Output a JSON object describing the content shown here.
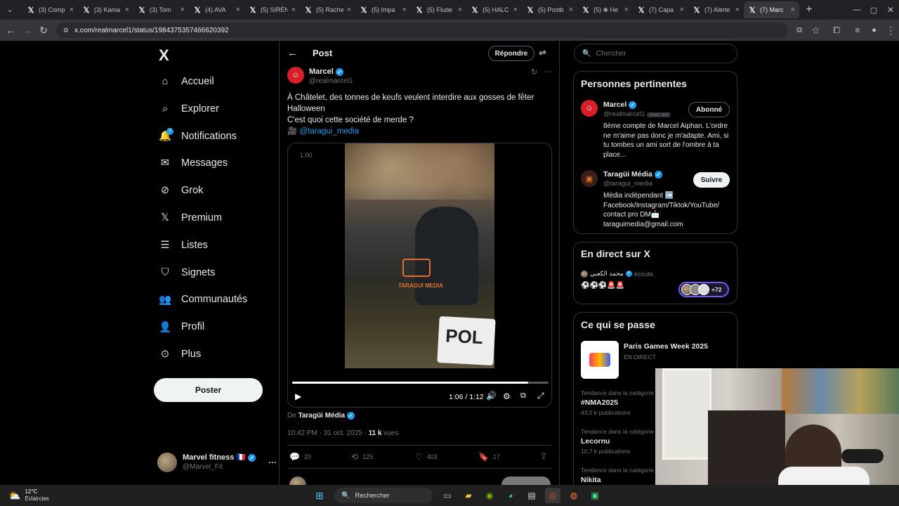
{
  "browser": {
    "tabs": [
      {
        "label": "(3) Comp"
      },
      {
        "label": "(3) Kama"
      },
      {
        "label": "(3) Tom"
      },
      {
        "label": "(4) AVA"
      },
      {
        "label": "(5) SIRÈN"
      },
      {
        "label": "(5) Rache"
      },
      {
        "label": "(5) Impa"
      },
      {
        "label": "(5) Flude"
      },
      {
        "label": "(5) HALC"
      },
      {
        "label": "(5) Postb"
      },
      {
        "label": "(5) ❀ He"
      },
      {
        "label": "(7) Capa"
      },
      {
        "label": "(7) Alerte"
      },
      {
        "label": "(7) Marc"
      }
    ],
    "url": "x.com/realmarcel1/status/1984375357466620392"
  },
  "nav": {
    "logo": "X",
    "items": [
      {
        "label": "Accueil",
        "icon": "home-icon"
      },
      {
        "label": "Explorer",
        "icon": "search-icon"
      },
      {
        "label": "Notifications",
        "icon": "bell-icon",
        "badge": "7"
      },
      {
        "label": "Messages",
        "icon": "mail-icon"
      },
      {
        "label": "Grok",
        "icon": "grok-icon"
      },
      {
        "label": "Premium",
        "icon": "x-premium-icon"
      },
      {
        "label": "Listes",
        "icon": "list-icon"
      },
      {
        "label": "Signets",
        "icon": "bookmark-icon"
      },
      {
        "label": "Communautés",
        "icon": "communities-icon"
      },
      {
        "label": "Profil",
        "icon": "profile-icon"
      },
      {
        "label": "Plus",
        "icon": "more-circle-icon"
      }
    ],
    "post_button": "Poster",
    "account": {
      "name": "Marvel fitness 🇫🇷",
      "handle": "@Marvel_Fit"
    }
  },
  "post": {
    "header": "Post",
    "reply_button": "Répondre",
    "author": {
      "name": "Marcel",
      "handle": "@realmarcel1"
    },
    "text_line1": "À Châtelet, des tonnes de keufs veulent interdire aux gosses de fêter Halloween",
    "text_line2": "C'est quoi cette société de merde ?",
    "mention": "@taragui_media",
    "video": {
      "speed": "1.00",
      "watermark": "TARAGUI MEDIA",
      "time": "1:06 / 1:12",
      "progress": 0.92
    },
    "from_label": "De",
    "from_name": "Taragüi Média",
    "timestamp": "10:42 PM · 31 oct. 2025 ·",
    "views_count": "11 k",
    "views_label": "vues",
    "stats": {
      "replies": "20",
      "reposts": "125",
      "likes": "403",
      "bookmarks": "17"
    }
  },
  "right": {
    "search_placeholder": "Chercher",
    "relevant": {
      "title": "Personnes pertinentes",
      "people": [
        {
          "name": "Marcel",
          "handle": "@realmarcel1",
          "follows_you": "Vous suit",
          "button": "Abonné",
          "bio": "8ème compte de Marcel Aiphan. L'ordre ne m'aime pas donc je m'adapte. Ami, si tu tombes un ami sort de l'ombre à ta place..."
        },
        {
          "name": "Taragüi Média",
          "handle": "@taragui_media",
          "button": "Suivre",
          "bio": "Média indépendant ➡️ Facebook/Instagram/Tiktok/YouTube/ contact pro DM📩 taraguimedia@gmail.com"
        }
      ]
    },
    "live": {
      "title": "En direct sur X",
      "host": "محمد الكعبي",
      "status": "écoute.",
      "emojis": "⚽⚽⚽🚨🚨",
      "listeners": "+72"
    },
    "trends": {
      "title": "Ce qui se passe",
      "event": {
        "name": "Paris Games Week 2025",
        "status": "EN DIRECT"
      },
      "items": [
        {
          "category": "Tendance dans la catégorie",
          "name": "#NMA2025",
          "count": "43,5 k publications"
        },
        {
          "category": "Tendance dans la catégorie",
          "name": "Lecornu",
          "count": "10,7 k publications"
        },
        {
          "category": "Tendance dans la catégorie",
          "name": "Nikita",
          "count": ""
        }
      ]
    }
  },
  "taskbar": {
    "weather_temp": "12°C",
    "weather_desc": "Éclaircies",
    "search_label": "Rechercher"
  }
}
